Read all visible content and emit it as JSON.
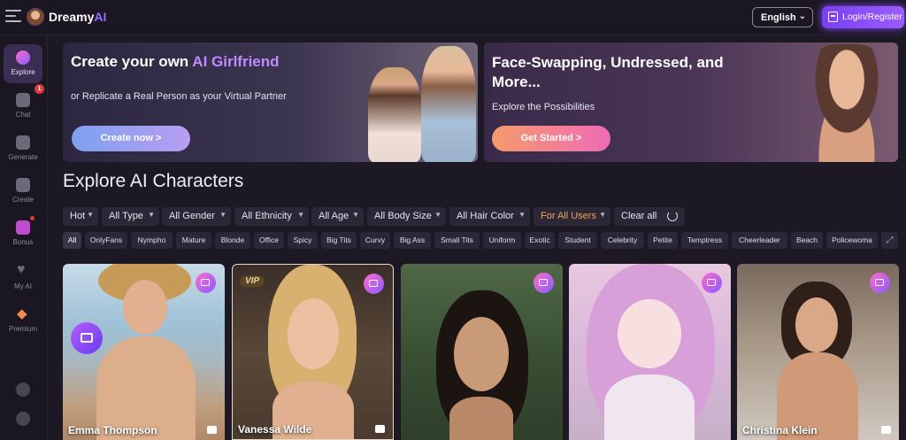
{
  "topbar": {
    "logo_text_main": "Dreamy",
    "logo_text_accent": "AI",
    "language": "English",
    "login_label": "Login/Register"
  },
  "sidebar": {
    "items": [
      {
        "label": "Explore",
        "icon": "compass-icon"
      },
      {
        "label": "Chat",
        "icon": "chat-icon",
        "badge": "1"
      },
      {
        "label": "Generate",
        "icon": "sparkle-icon"
      },
      {
        "label": "Create",
        "icon": "magic-wand-icon"
      },
      {
        "label": "Bonus",
        "icon": "gift-icon"
      },
      {
        "label": "My AI",
        "icon": "heart-icon"
      },
      {
        "label": "Premium",
        "icon": "diamond-icon"
      }
    ]
  },
  "banner1": {
    "title_prefix": "Create your own ",
    "title_accent": "AI Girlfriend",
    "subtitle": "or Replicate a Real Person as your Virtual Partner",
    "button": "Create now >"
  },
  "banner2": {
    "title": "Face-Swapping, Undressed, and More...",
    "subtitle": "Explore the Possibilities",
    "button": "Get Started >"
  },
  "section_title": "Explore AI Characters",
  "filters": [
    "Hot",
    "All Type",
    "All Gender",
    "All Ethnicity",
    "All Age",
    "All Body Size",
    "All Hair Color",
    "For All Users",
    "Clear all"
  ],
  "tags": [
    "All",
    "OnlyFans",
    "Nympho",
    "Mature",
    "Blonde",
    "Office",
    "Spicy",
    "Big Tits",
    "Curvy",
    "Big Ass",
    "Small Tits",
    "Uniform",
    "Exotic",
    "Student",
    "Celebrity",
    "Petite",
    "Temptress",
    "Cheerleader",
    "Beach",
    "Policewoma"
  ],
  "cards": [
    {
      "name": "Emma Thompson"
    },
    {
      "name": "Vanessa Wilde",
      "vip": "VIP"
    },
    {
      "name": ""
    },
    {
      "name": ""
    },
    {
      "name": "Christina Klein"
    }
  ],
  "colors": {
    "accent": "#9b6bff",
    "background": "#1c1824"
  }
}
